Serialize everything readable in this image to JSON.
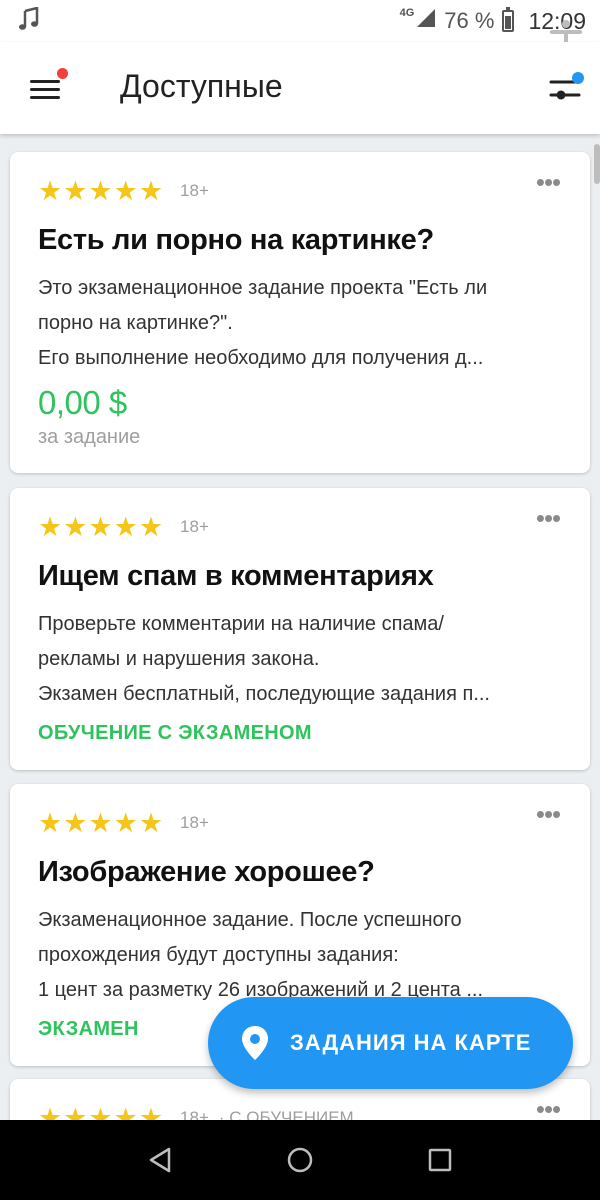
{
  "status_bar": {
    "notification_icon": "music-note-icon",
    "network": "4G",
    "battery": "76 %",
    "time": "12:09"
  },
  "app_bar": {
    "title": "Доступные",
    "menu_icon": "hamburger-menu-icon",
    "filter_icon": "filter-sliders-icon",
    "menu_badge_color": "#f0413c",
    "filter_accent_color": "#2196f3"
  },
  "cards": [
    {
      "stars": "★★★★★",
      "age": "18+",
      "title": "Есть ли порно на картинке?",
      "desc": [
        "Это экзаменационное задание проекта \"Есть ли",
        "порно на картинке?\".",
        "Его выполнение необходимо для получения д..."
      ],
      "price": "0,00 $",
      "per": "за задание"
    },
    {
      "stars": "★★★★★",
      "age": "18+",
      "title": "Ищем спам в комментариях",
      "desc": [
        "Проверьте комментарии на наличие спама/",
        "рекламы и нарушения закона.",
        "Экзамен бесплатный, последующие задания п..."
      ],
      "badge": "ОБУЧЕНИЕ С ЭКЗАМЕНОМ"
    },
    {
      "stars": "★★★★★",
      "age": "18+",
      "title": "Изображение хорошее?",
      "desc": [
        "Экзаменационное задание. После успешного",
        "прохождения будут доступны задания:",
        "1 цент за разметку 26 изображений и 2 цента ..."
      ],
      "badge": "ЭКЗАМЕН"
    },
    {
      "stars": "★★★★★",
      "age": "18+",
      "tag": "· С ОБУЧЕНИЕМ"
    }
  ],
  "fab": {
    "label": "ЗАДАНИЯ НА КАРТЕ",
    "icon": "map-pin-icon",
    "color": "#2196f3"
  },
  "colors": {
    "star": "#f5c518",
    "reward_green": "#2fc35e"
  }
}
